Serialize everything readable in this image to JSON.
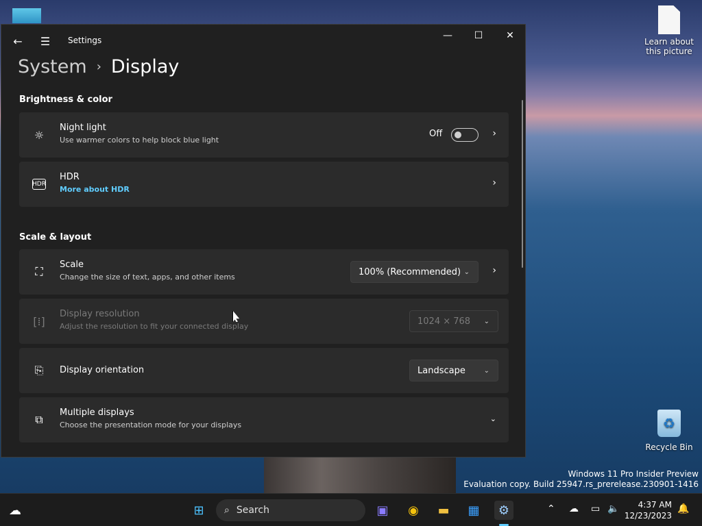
{
  "desktop": {
    "doc_icon_label": "Learn about this picture",
    "recycle_bin_label": "Recycle Bin",
    "watermark_line1": "Windows 11 Pro Insider Preview",
    "watermark_line2": "Evaluation copy. Build 25947.rs_prerelease.230901-1416"
  },
  "window": {
    "app_title": "Settings",
    "breadcrumb_parent": "System",
    "breadcrumb_sep": "›",
    "breadcrumb_current": "Display"
  },
  "sections": {
    "brightness_title": "Brightness & color",
    "scale_title": "Scale & layout"
  },
  "cards": {
    "night_light": {
      "title": "Night light",
      "subtitle": "Use warmer colors to help block blue light",
      "state_label": "Off",
      "enabled": false
    },
    "hdr": {
      "title": "HDR",
      "link": "More about HDR"
    },
    "scale": {
      "title": "Scale",
      "subtitle": "Change the size of text, apps, and other items",
      "value": "100% (Recommended)"
    },
    "resolution": {
      "title": "Display resolution",
      "subtitle": "Adjust the resolution to fit your connected display",
      "value": "1024 × 768"
    },
    "orientation": {
      "title": "Display orientation",
      "value": "Landscape"
    },
    "multiple": {
      "title": "Multiple displays",
      "subtitle": "Choose the presentation mode for your displays"
    }
  },
  "taskbar": {
    "search_label": "Search",
    "time": "4:37 AM",
    "date": "12/23/2023"
  },
  "colors": {
    "accent": "#60cdff",
    "window_bg": "#202020",
    "card_bg": "#2b2b2b"
  }
}
